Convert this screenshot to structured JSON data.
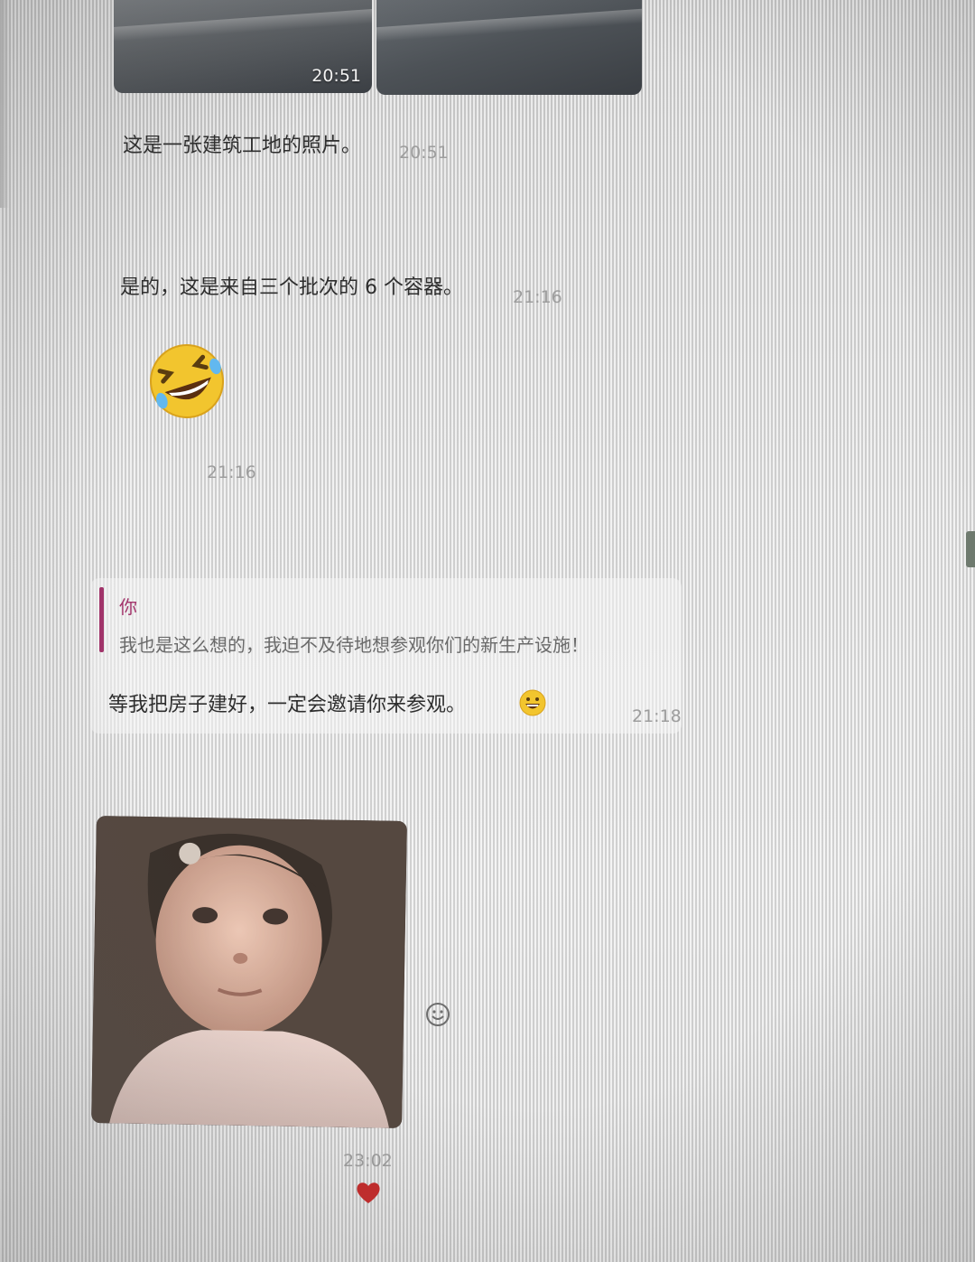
{
  "chat": {
    "photo_top": {
      "time": "20:51"
    },
    "msg1": {
      "text": "这是一张建筑工地的照片。",
      "time": "20:51"
    },
    "msg2": {
      "text": "是的，这是来自三个批次的 6 个容器。",
      "time": "21:16"
    },
    "sticker": {
      "icon": "rolling-laughing-emoji",
      "time": "21:16"
    },
    "reply": {
      "quote_sender": "你",
      "quote_text": "我也是这么想的，我迫不及待地想参观你们的新生产设施！",
      "text": "等我把房子建好，一定会邀请你来参观。",
      "inline_icon": "grinning-emoji",
      "time": "21:18"
    },
    "photo_bottom": {
      "time": "23:02",
      "reaction_icon": "heart-icon",
      "react_button_icon": "smiley-icon"
    }
  },
  "colors": {
    "quote_accent": "#a2346a",
    "timestamp": "#9d9d9d",
    "heart": "#c62a2a"
  }
}
